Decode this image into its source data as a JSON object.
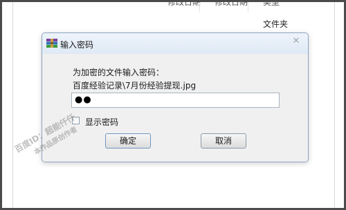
{
  "background": {
    "column_headers": [
      "修改日期",
      "修改日期"
    ],
    "column_header_3": "类型",
    "type_value": "文件夹"
  },
  "dialog": {
    "title": "输入密码",
    "title_icon": "winrar-archive-icon",
    "close_icon": "close-icon",
    "close_glyph": "✕",
    "prompt": "为加密的文件输入密码：",
    "file_path": "百度经验记录\\7月份经验提现.jpg",
    "password_masked": "●●",
    "show_password_label": "显示密码",
    "show_password_checked": false,
    "ok_label": "确定",
    "cancel_label": "取消"
  },
  "watermark": {
    "line1": "百度ID：超能仟仟",
    "line2": "本作品原创作者"
  },
  "colors": {
    "dialog_border": "#8da4bf",
    "titlebar": "#dfe9f5",
    "body": "#f0f0f0"
  }
}
